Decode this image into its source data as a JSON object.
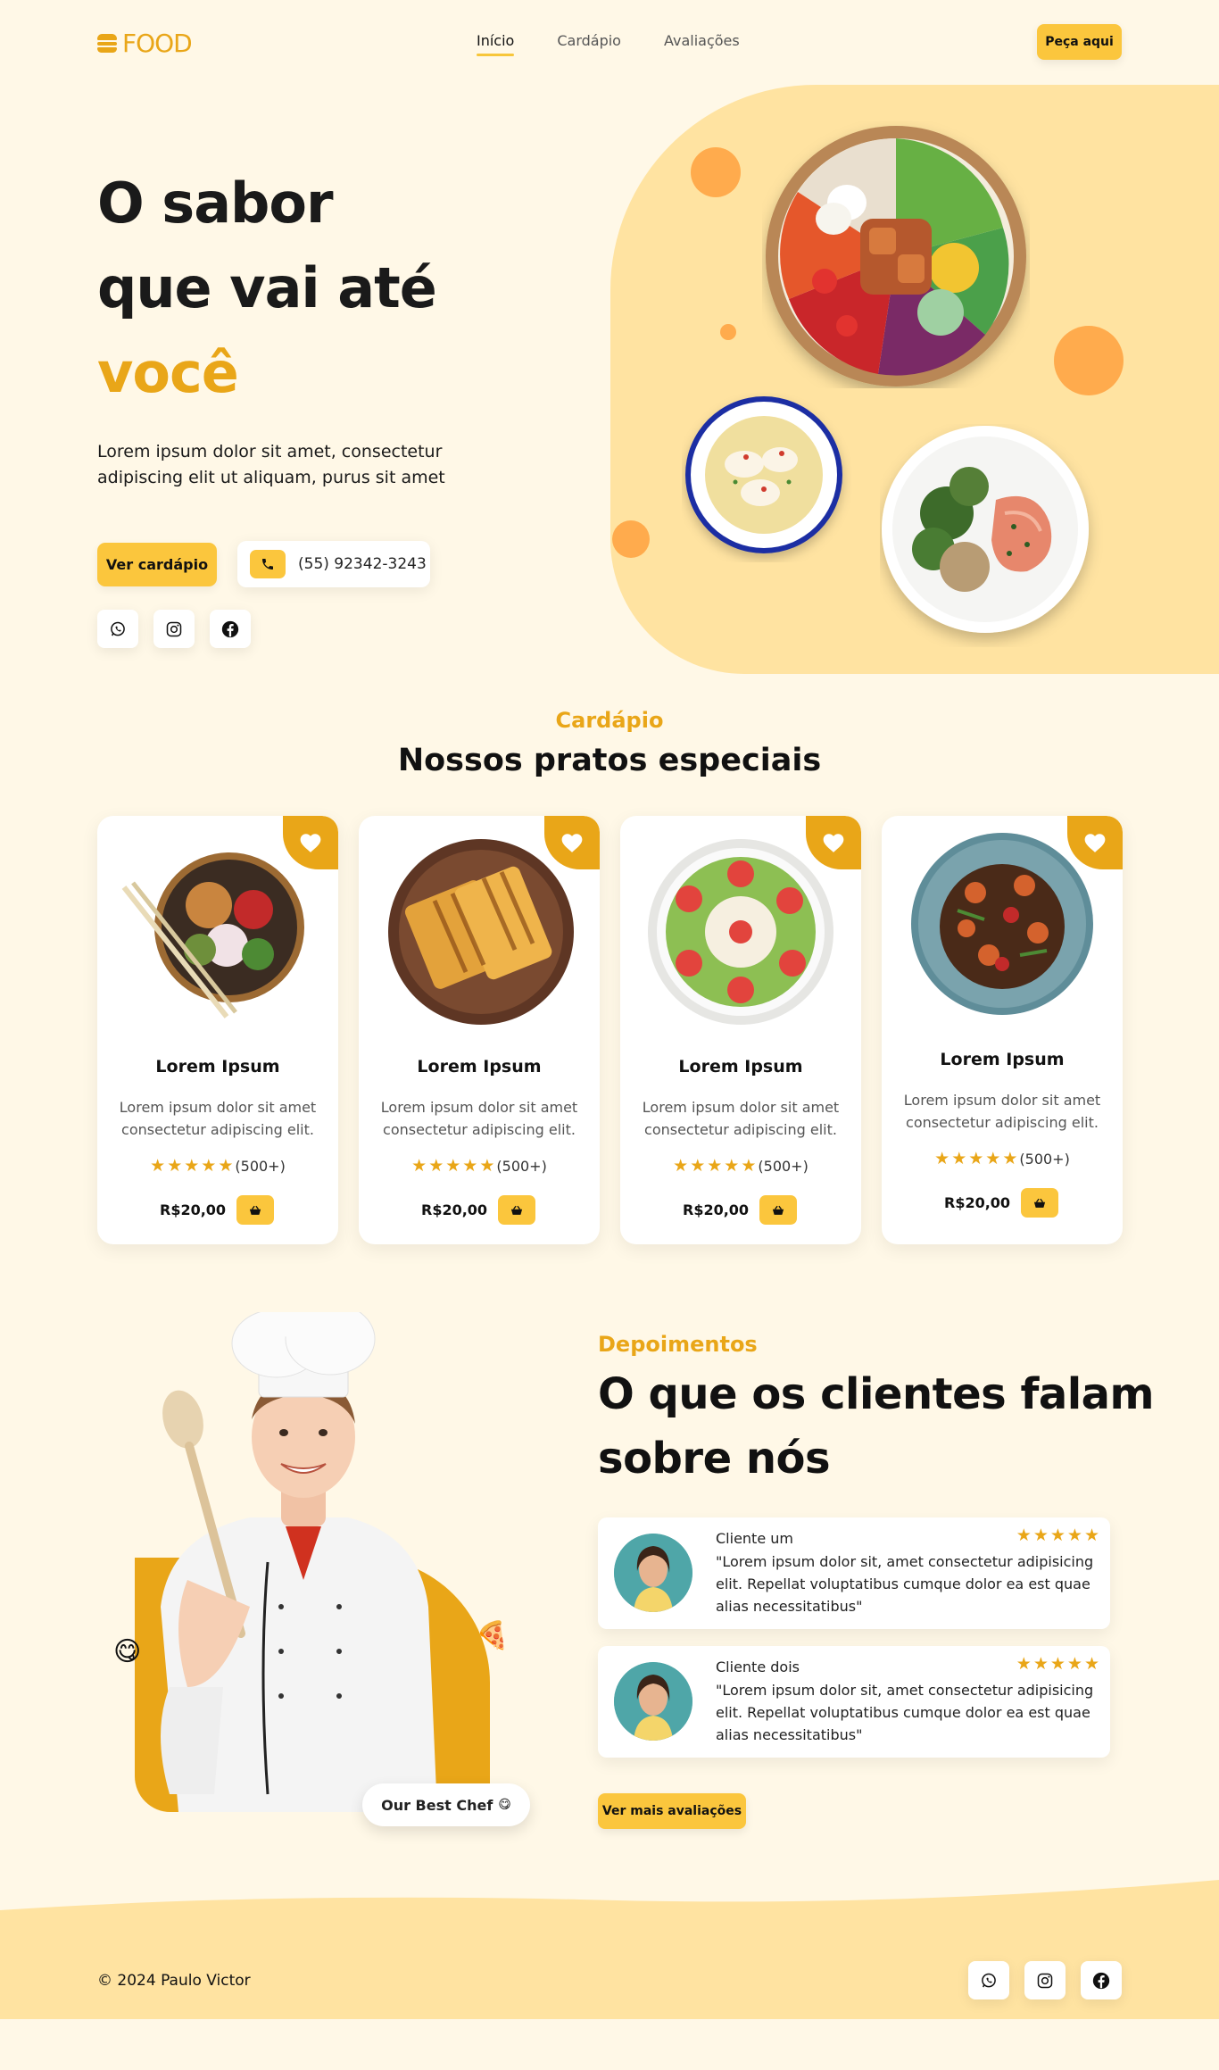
{
  "brand": {
    "logo_text": "FOOD",
    "accent": "#e9a618",
    "button_yellow": "#fbc63d",
    "background": "#fff8e7"
  },
  "nav": {
    "links": [
      "Início",
      "Cardápio",
      "Avaliações"
    ],
    "active": "Início",
    "order_label": "Peça aqui"
  },
  "hero": {
    "title_line1": "O sabor",
    "title_line2": "que vai até",
    "title_accent": "você",
    "description": "Lorem ipsum dolor sit amet, consectetur adipiscing elit ut aliquam, purus sit amet",
    "menu_button": "Ver cardápio",
    "phone": "(55) 92342-3243",
    "socials": [
      "whatsapp-icon",
      "instagram-icon",
      "facebook-icon"
    ]
  },
  "menu": {
    "kicker": "Cardápio",
    "title": "Nossos pratos especiais",
    "cards": [
      {
        "name": "Lorem Ipsum",
        "desc": "Lorem ipsum dolor sit amet consectetur adipiscing elit.",
        "reviews": "(500+)",
        "rating": 5,
        "price": "R$20,00"
      },
      {
        "name": "Lorem Ipsum",
        "desc": "Lorem ipsum dolor sit amet consectetur adipiscing elit.",
        "reviews": "(500+)",
        "rating": 5,
        "price": "R$20,00"
      },
      {
        "name": "Lorem Ipsum",
        "desc": "Lorem ipsum dolor sit amet consectetur adipiscing elit.",
        "reviews": "(500+)",
        "rating": 5,
        "price": "R$20,00"
      },
      {
        "name": "Lorem Ipsum",
        "desc": "Lorem ipsum dolor sit amet consectetur adipiscing elit.",
        "reviews": "(500+)",
        "rating": 5,
        "price": "R$20,00"
      }
    ]
  },
  "testimonials": {
    "kicker": "Depoimentos",
    "title": "O que os clientes falam sobre nós",
    "best_chef_label": "Our Best Chef",
    "reviews": [
      {
        "name": "Cliente um",
        "rating": 5,
        "text": "\"Lorem ipsum dolor sit, amet consectetur adipisicing elit. Repellat voluptatibus cumque dolor ea est quae alias necessitatibus\""
      },
      {
        "name": "Cliente dois",
        "rating": 5,
        "text": "\"Lorem ipsum dolor sit, amet consectetur adipisicing elit. Repellat voluptatibus cumque dolor ea est quae alias necessitatibus\""
      }
    ],
    "more_button": "Ver mais avaliações"
  },
  "footer": {
    "copyright": "© 2024 Paulo Victor",
    "socials": [
      "whatsapp-icon",
      "instagram-icon",
      "facebook-icon"
    ]
  }
}
